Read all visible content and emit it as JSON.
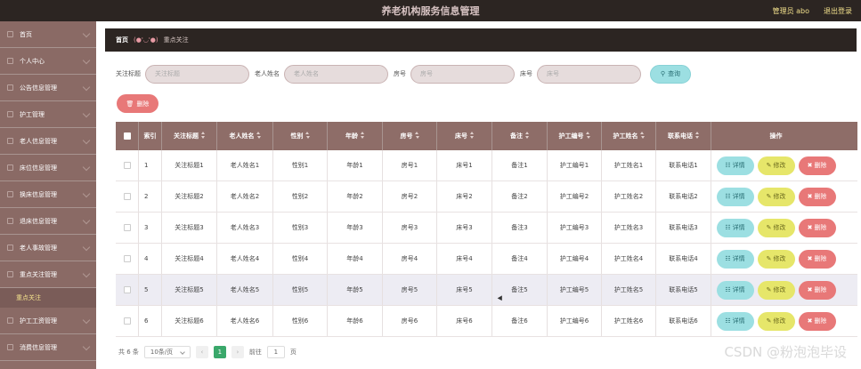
{
  "topbar": {
    "title": "养老机构服务信息管理",
    "user": "管理员 abo",
    "logout": "退出登录"
  },
  "sidebar": {
    "items": [
      {
        "label": "首页"
      },
      {
        "label": "个人中心"
      },
      {
        "label": "公告信息管理"
      },
      {
        "label": "护工管理"
      },
      {
        "label": "老人信息管理"
      },
      {
        "label": "床位信息管理"
      },
      {
        "label": "换床信息管理"
      },
      {
        "label": "退床信息管理"
      },
      {
        "label": "老人事故管理"
      },
      {
        "label": "重点关注管理"
      }
    ],
    "active_sub": "重点关注",
    "items_after": [
      {
        "label": "护工工资管理"
      },
      {
        "label": "消费信息管理"
      }
    ]
  },
  "breadcrumb": {
    "home": "首页",
    "emote": "(●'◡'●)",
    "current": "重点关注"
  },
  "search": {
    "title_label": "关注标题",
    "title_placeholder": "关注标题",
    "name_label": "老人姓名",
    "name_placeholder": "老人姓名",
    "room_label": "房号",
    "room_placeholder": "房号",
    "bed_label": "床号",
    "bed_placeholder": "床号",
    "query_label": "查询"
  },
  "delete_button": "删除",
  "table": {
    "headers": {
      "index": "索引",
      "title": "关注标题",
      "name": "老人姓名",
      "gender": "性别",
      "age": "年龄",
      "room": "房号",
      "bed": "床号",
      "note": "备注",
      "nurse_no": "护工编号",
      "nurse_name": "护工姓名",
      "phone": "联系电话",
      "ops": "操作"
    },
    "rows": [
      {
        "index": "1",
        "title": "关注标题1",
        "name": "老人姓名1",
        "gender": "性别1",
        "age": "年龄1",
        "room": "房号1",
        "bed": "床号1",
        "note": "备注1",
        "nurse_no": "护工编号1",
        "nurse_name": "护工姓名1",
        "phone": "联系电话1"
      },
      {
        "index": "2",
        "title": "关注标题2",
        "name": "老人姓名2",
        "gender": "性别2",
        "age": "年龄2",
        "room": "房号2",
        "bed": "床号2",
        "note": "备注2",
        "nurse_no": "护工编号2",
        "nurse_name": "护工姓名2",
        "phone": "联系电话2"
      },
      {
        "index": "3",
        "title": "关注标题3",
        "name": "老人姓名3",
        "gender": "性别3",
        "age": "年龄3",
        "room": "房号3",
        "bed": "床号3",
        "note": "备注3",
        "nurse_no": "护工编号3",
        "nurse_name": "护工姓名3",
        "phone": "联系电话3"
      },
      {
        "index": "4",
        "title": "关注标题4",
        "name": "老人姓名4",
        "gender": "性别4",
        "age": "年龄4",
        "room": "房号4",
        "bed": "床号4",
        "note": "备注4",
        "nurse_no": "护工编号4",
        "nurse_name": "护工姓名4",
        "phone": "联系电话4"
      },
      {
        "index": "5",
        "title": "关注标题5",
        "name": "老人姓名5",
        "gender": "性别5",
        "age": "年龄5",
        "room": "房号5",
        "bed": "床号5",
        "note": "备注5",
        "nurse_no": "护工编号5",
        "nurse_name": "护工姓名5",
        "phone": "联系电话5"
      },
      {
        "index": "6",
        "title": "关注标题6",
        "name": "老人姓名6",
        "gender": "性别6",
        "age": "年龄6",
        "room": "房号6",
        "bed": "床号6",
        "note": "备注6",
        "nurse_no": "护工编号6",
        "nurse_name": "护工姓名6",
        "phone": "联系电话6"
      }
    ],
    "op_detail": "详情",
    "op_edit": "修改",
    "op_delete": "删除"
  },
  "pager": {
    "total": "共 6 条",
    "page_size": "10条/页",
    "current": "1",
    "goto_label": "前往",
    "goto_value": "1",
    "page_suffix": "页"
  },
  "watermark": "CSDN @粉泡泡毕设",
  "colors": {
    "topbar": "#2c2522",
    "sidebar": "#8e6d68",
    "header_row": "#8e6d68",
    "detail_btn": "#9cdfe2",
    "edit_btn": "#e6e66a",
    "delete_btn": "#e87878",
    "pager_active": "#3aa86b"
  }
}
